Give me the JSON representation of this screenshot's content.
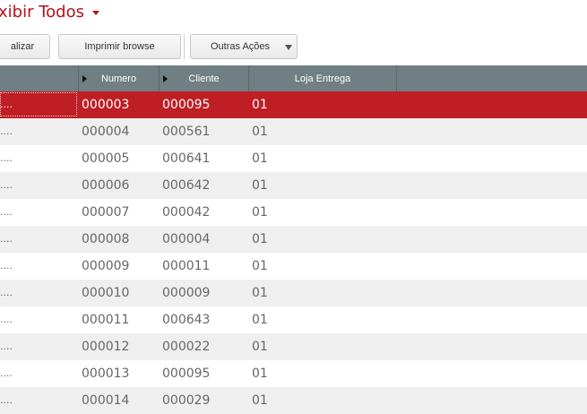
{
  "header": {
    "title": "xibir Todos"
  },
  "toolbar": {
    "update_label": "alizar",
    "print_label": "Imprimir browse",
    "more_label": "Outras Ações"
  },
  "grid": {
    "columns": [
      "",
      "Numero",
      "Cliente",
      "Loja Entrega"
    ],
    "selected_row": 0,
    "rows": [
      {
        "c0": "....",
        "numero": "000003",
        "cliente": "000095",
        "loja": "01"
      },
      {
        "c0": "....",
        "numero": "000004",
        "cliente": "000561",
        "loja": "01"
      },
      {
        "c0": "....",
        "numero": "000005",
        "cliente": "000641",
        "loja": "01"
      },
      {
        "c0": "....",
        "numero": "000006",
        "cliente": "000642",
        "loja": "01"
      },
      {
        "c0": "....",
        "numero": "000007",
        "cliente": "000042",
        "loja": "01"
      },
      {
        "c0": "....",
        "numero": "000008",
        "cliente": "000004",
        "loja": "01"
      },
      {
        "c0": "....",
        "numero": "000009",
        "cliente": "000011",
        "loja": "01"
      },
      {
        "c0": "....",
        "numero": "000010",
        "cliente": "000009",
        "loja": "01"
      },
      {
        "c0": "....",
        "numero": "000011",
        "cliente": "000643",
        "loja": "01"
      },
      {
        "c0": "....",
        "numero": "000012",
        "cliente": "000022",
        "loja": "01"
      },
      {
        "c0": "....",
        "numero": "000013",
        "cliente": "000095",
        "loja": "01"
      },
      {
        "c0": "....",
        "numero": "000014",
        "cliente": "000029",
        "loja": "01"
      }
    ]
  },
  "colors": {
    "accent": "#be1e24",
    "header_bg": "#707f83"
  }
}
